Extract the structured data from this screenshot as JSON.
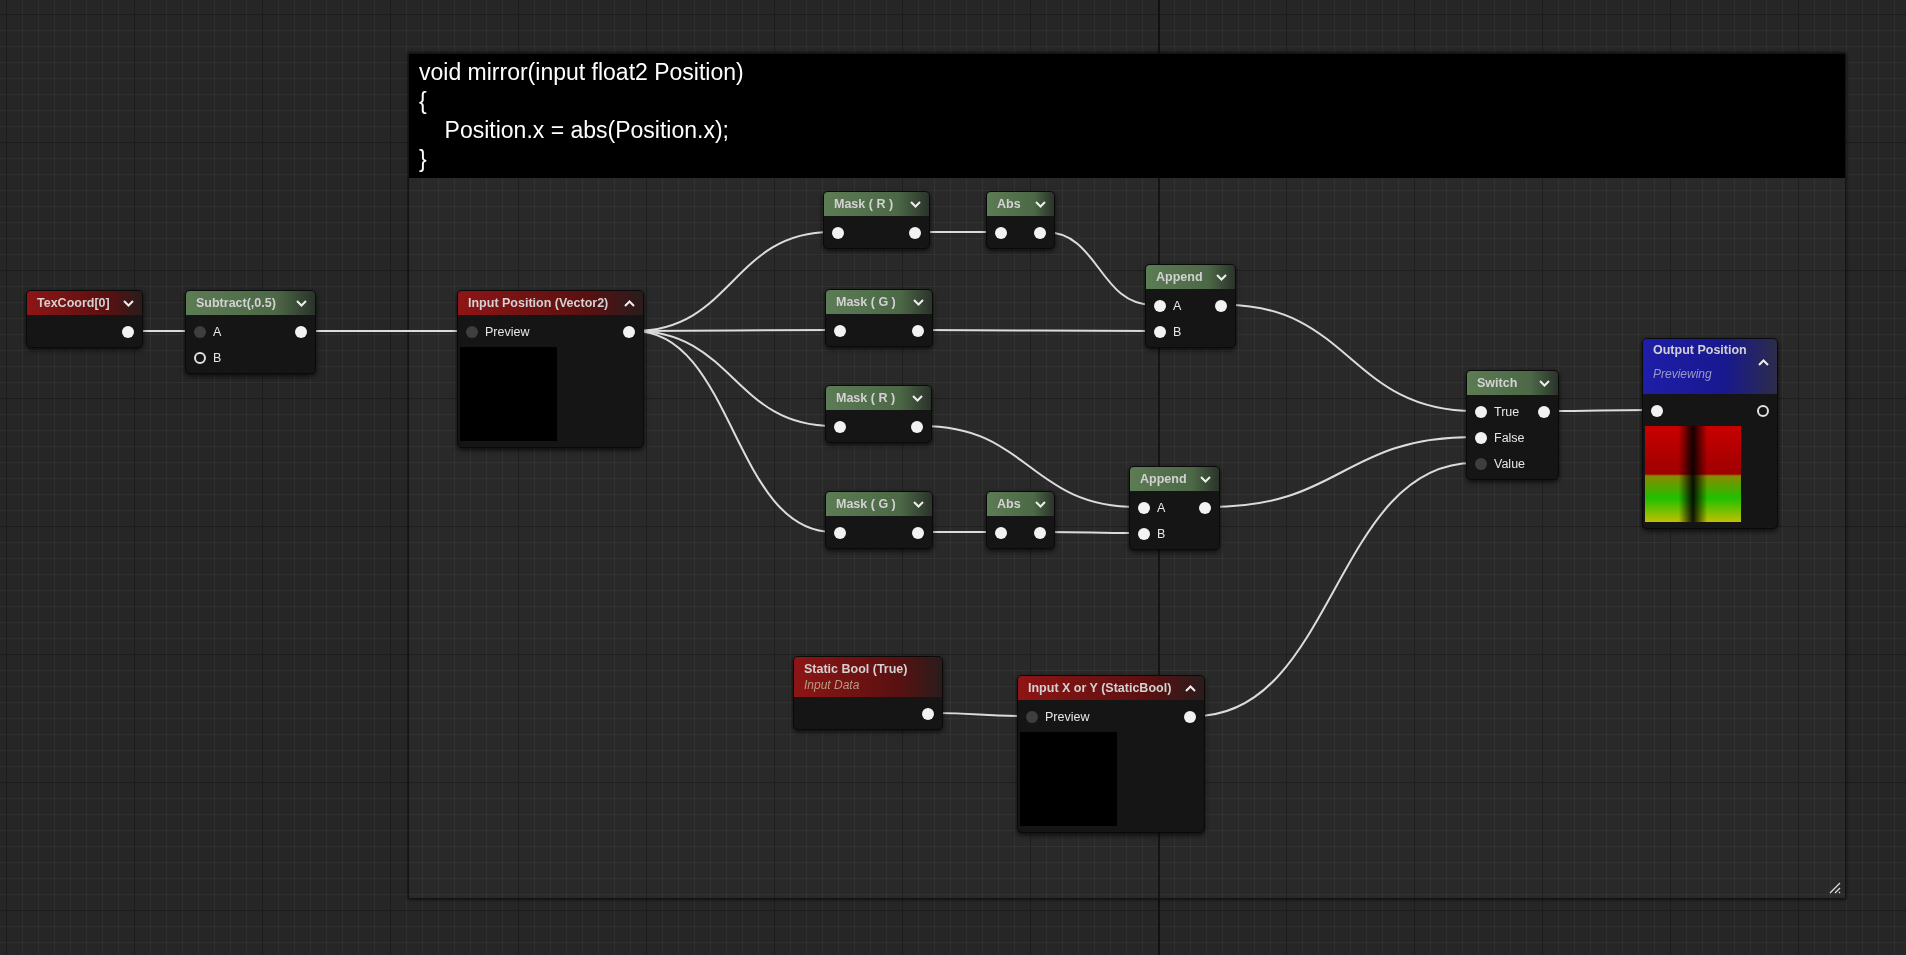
{
  "comment": {
    "code_lines": [
      "void mirror(input float2 Position)",
      "{",
      "    Position.x = abs(Position.x);",
      "}"
    ]
  },
  "nodes": [
    {
      "title": "TexCoord[0]",
      "kind": "param",
      "expanded": false,
      "outputs": [
        {
          "kind": "filled"
        }
      ]
    },
    {
      "title": "Subtract(,0.5)",
      "kind": "function",
      "expanded": false,
      "inputs": [
        {
          "label": "A",
          "kind": "dim"
        },
        {
          "label": "B",
          "kind": "hollow"
        }
      ],
      "outputs": [
        {
          "kind": "filled"
        }
      ]
    },
    {
      "title": "Input Position (Vector2)",
      "kind": "param",
      "expanded": true,
      "preview": true,
      "inputs": [
        {
          "label": "Preview",
          "kind": "dim"
        }
      ],
      "outputs": [
        {
          "kind": "filled"
        }
      ]
    },
    {
      "title": "Mask ( R )",
      "kind": "function",
      "expanded": false,
      "inputs": [
        {
          "kind": "filled"
        }
      ],
      "outputs": [
        {
          "kind": "filled"
        }
      ]
    },
    {
      "title": "Abs",
      "kind": "function",
      "expanded": false,
      "inputs": [
        {
          "kind": "filled"
        }
      ],
      "outputs": [
        {
          "kind": "filled"
        }
      ]
    },
    {
      "title": "Mask ( G )",
      "kind": "function",
      "expanded": false,
      "inputs": [
        {
          "kind": "filled"
        }
      ],
      "outputs": [
        {
          "kind": "filled"
        }
      ]
    },
    {
      "title": "Append",
      "kind": "function",
      "expanded": false,
      "inputs": [
        {
          "label": "A",
          "kind": "filled"
        },
        {
          "label": "B",
          "kind": "filled"
        }
      ],
      "outputs": [
        {
          "kind": "filled"
        }
      ]
    },
    {
      "title": "Mask ( R )",
      "kind": "function",
      "expanded": false,
      "inputs": [
        {
          "kind": "filled"
        }
      ],
      "outputs": [
        {
          "kind": "filled"
        }
      ]
    },
    {
      "title": "Mask ( G )",
      "kind": "function",
      "expanded": false,
      "inputs": [
        {
          "kind": "filled"
        }
      ],
      "outputs": [
        {
          "kind": "filled"
        }
      ]
    },
    {
      "title": "Abs",
      "kind": "function",
      "expanded": false,
      "inputs": [
        {
          "kind": "filled"
        }
      ],
      "outputs": [
        {
          "kind": "filled"
        }
      ]
    },
    {
      "title": "Append",
      "kind": "function",
      "expanded": false,
      "inputs": [
        {
          "label": "A",
          "kind": "filled"
        },
        {
          "label": "B",
          "kind": "filled"
        }
      ],
      "outputs": [
        {
          "kind": "filled"
        }
      ]
    },
    {
      "title": "Switch",
      "kind": "function",
      "expanded": false,
      "inputs": [
        {
          "label": "True",
          "kind": "filled"
        },
        {
          "label": "False",
          "kind": "filled"
        },
        {
          "label": "Value",
          "kind": "dim"
        }
      ],
      "outputs": [
        {
          "kind": "filled"
        }
      ]
    },
    {
      "title": "Output Position",
      "subtitle": "Previewing",
      "kind": "output",
      "expanded": true,
      "preview": true,
      "inputs": [
        {
          "kind": "filled"
        }
      ],
      "outputs": [
        {
          "kind": "hollow"
        }
      ]
    },
    {
      "title": "Static Bool (True)",
      "subtitle": "Input Data",
      "kind": "param",
      "outputs": [
        {
          "kind": "filled"
        }
      ]
    },
    {
      "title": "Input X or Y (StaticBool)",
      "kind": "param",
      "expanded": true,
      "preview": true,
      "inputs": [
        {
          "label": "Preview",
          "kind": "dim"
        }
      ],
      "outputs": [
        {
          "kind": "filled"
        }
      ]
    }
  ]
}
